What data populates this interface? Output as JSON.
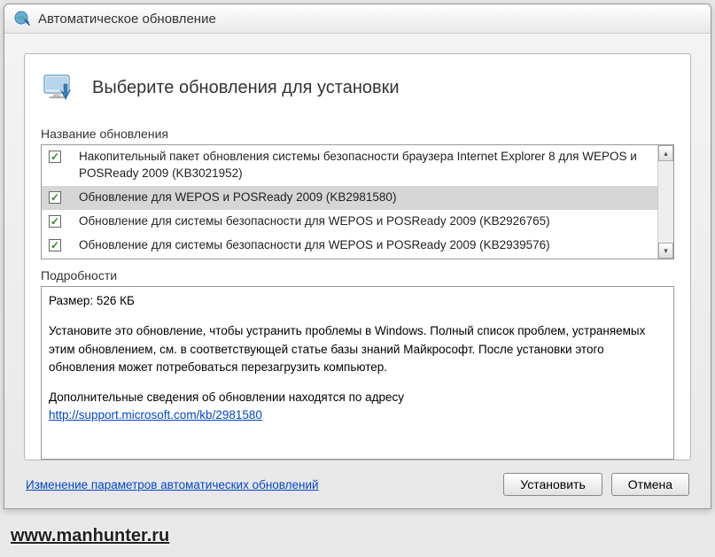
{
  "window": {
    "title": "Автоматическое обновление"
  },
  "header": {
    "title": "Выберите обновления для установки"
  },
  "list": {
    "label": "Название обновления",
    "items": [
      {
        "checked": true,
        "selected": false,
        "text": "Накопительный пакет обновления системы безопасности браузера Internet Explorer 8 для WEPOS и POSReady 2009 (KB3021952)"
      },
      {
        "checked": true,
        "selected": true,
        "text": "Обновление для WEPOS и POSReady 2009 (KB2981580)"
      },
      {
        "checked": true,
        "selected": false,
        "text": "Обновление для системы безопасности для WEPOS и POSReady 2009 (KB2926765)"
      },
      {
        "checked": true,
        "selected": false,
        "text": "Обновление для системы безопасности для WEPOS и POSReady 2009 (KB2939576)"
      }
    ]
  },
  "details": {
    "label": "Подробности",
    "size": "Размер: 526 КБ",
    "description": "Установите это обновление, чтобы устранить проблемы в Windows. Полный список проблем, устраняемых этим обновлением, см. в соответствующей статье базы знаний Майкрософт. После установки этого обновления может потребоваться перезагрузить компьютер.",
    "moreinfo": "Дополнительные сведения об обновлении находятся по адресу",
    "link": "http://support.microsoft.com/kb/2981580"
  },
  "footer": {
    "settings_link": "Изменение параметров автоматических обновлений",
    "install": "Установить",
    "cancel": "Отмена"
  },
  "watermark": "www.manhunter.ru"
}
